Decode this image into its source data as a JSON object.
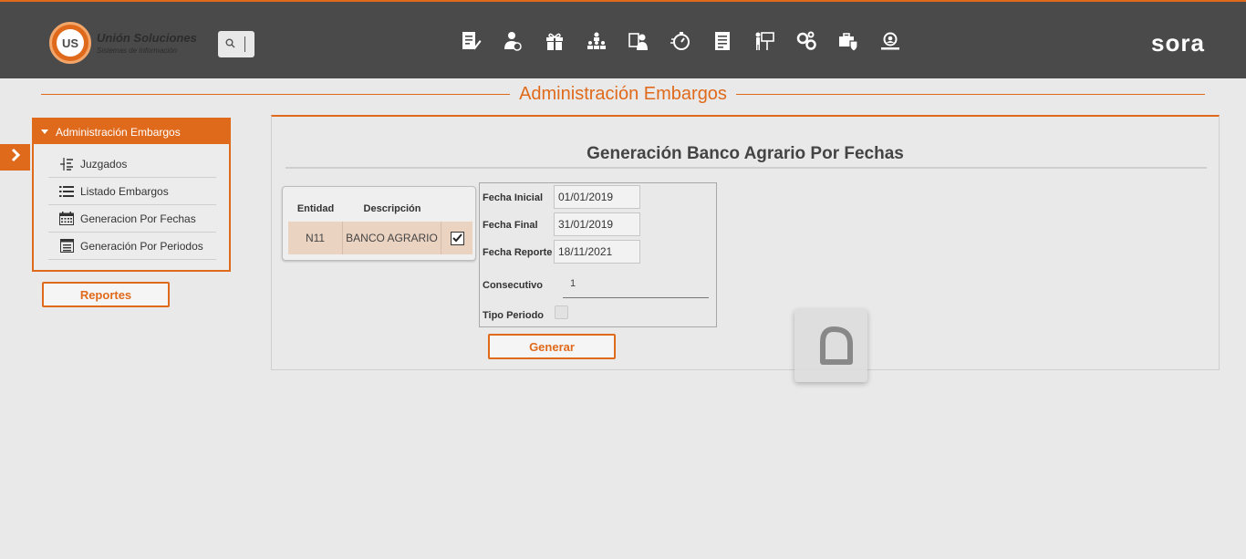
{
  "header": {
    "logo_title": "Unión Soluciones",
    "logo_subtitle": "Sistemas de Información",
    "logo_mark": "US",
    "brand": "sora",
    "nav_icons": [
      "document-edit-icon",
      "user-money-icon",
      "gift-icon",
      "org-chart-icon",
      "user-id-icon",
      "stopwatch-icon",
      "report-icon",
      "presentation-icon",
      "gears-icon",
      "briefcase-shield-icon",
      "user-search-icon"
    ]
  },
  "page": {
    "title": "Administración Embargos"
  },
  "menu": {
    "header": "Administración Embargos",
    "items": [
      {
        "label": "Juzgados",
        "icon": "indent-list-icon"
      },
      {
        "label": "Listado Embargos",
        "icon": "list-icon"
      },
      {
        "label": "Generacion Por Fechas",
        "icon": "calendar-icon"
      },
      {
        "label": "Generación Por Periodos",
        "icon": "table-list-icon"
      }
    ],
    "reports_button": "Reportes"
  },
  "panel": {
    "title": "Generación Banco Agrario Por Fechas",
    "grid": {
      "columns": [
        "Entidad",
        "Descripción"
      ],
      "rows": [
        {
          "entidad": "N11",
          "descripcion": "BANCO AGRARIO",
          "checked": true
        }
      ]
    },
    "form": {
      "fecha_inicial_label": "Fecha Inicial",
      "fecha_inicial": "01/01/2019",
      "fecha_final_label": "Fecha Final",
      "fecha_final": "31/01/2019",
      "fecha_reporte_label": "Fecha Reporte",
      "fecha_reporte": "18/11/2021",
      "consecutivo_label": "Consecutivo",
      "consecutivo": "1",
      "tipo_periodo_label": "Tipo Periodo",
      "tipo_periodo_checked": false
    },
    "generate_button": "Generar"
  },
  "colors": {
    "accent": "#e06a1c",
    "topbar": "#4a4a4a",
    "row_selected": "#ebd3c1"
  }
}
